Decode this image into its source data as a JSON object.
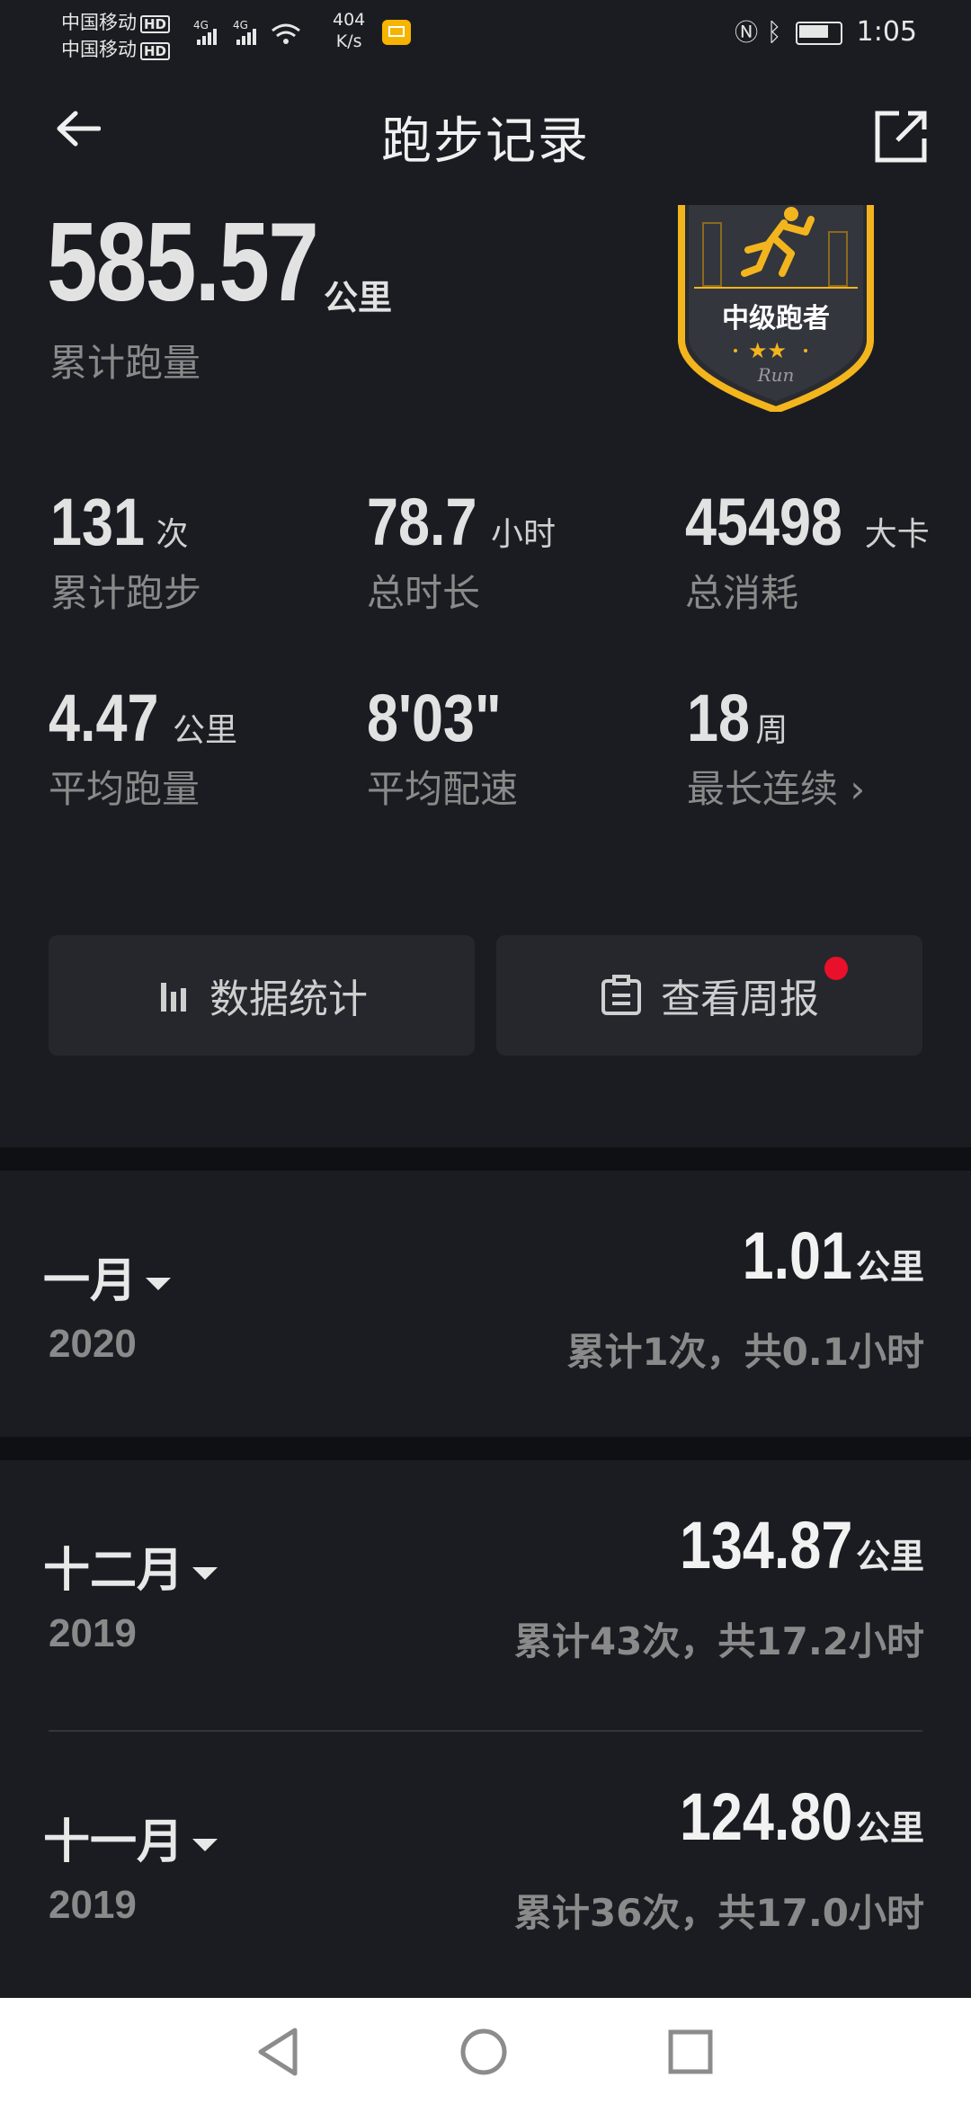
{
  "status_bar": {
    "carrier_1": "中国移动",
    "carrier_2": "中国移动",
    "hd": "HD",
    "net": "4G",
    "speed_value": "404",
    "speed_unit": "K/s",
    "time": "1:05"
  },
  "header": {
    "title": "跑步记录"
  },
  "summary": {
    "total_distance": "585.57",
    "total_distance_unit": "公里",
    "total_distance_label": "累计跑量",
    "badge_title": "中级跑者",
    "badge_sub": "Run"
  },
  "stats": [
    {
      "value": "131",
      "unit": "次",
      "label": "累计跑步"
    },
    {
      "value": "78.7",
      "unit": "小时",
      "label": "总时长"
    },
    {
      "value": "45498",
      "unit": "大卡",
      "label": "总消耗"
    },
    {
      "value": "4.47",
      "unit": "公里",
      "label": "平均跑量"
    },
    {
      "value": "8'03\"",
      "unit": "",
      "label": "平均配速"
    },
    {
      "value": "18",
      "unit": "周",
      "label": "最长连续"
    }
  ],
  "buttons": {
    "stats_label": "数据统计",
    "weekly_label": "查看周报"
  },
  "months": [
    {
      "month": "一月",
      "year": "2020",
      "distance": "1.01",
      "unit": "公里",
      "summary": "累计1次，共0.1小时"
    },
    {
      "month": "十二月",
      "year": "2019",
      "distance": "134.87",
      "unit": "公里",
      "summary": "累计43次，共17.2小时"
    },
    {
      "month": "十一月",
      "year": "2019",
      "distance": "124.80",
      "unit": "公里",
      "summary": "累计36次，共17.0小时"
    }
  ],
  "colors": {
    "background": "#1b1c21",
    "badge_gold": "#f3b51d",
    "notification_dot": "#e8102a"
  }
}
